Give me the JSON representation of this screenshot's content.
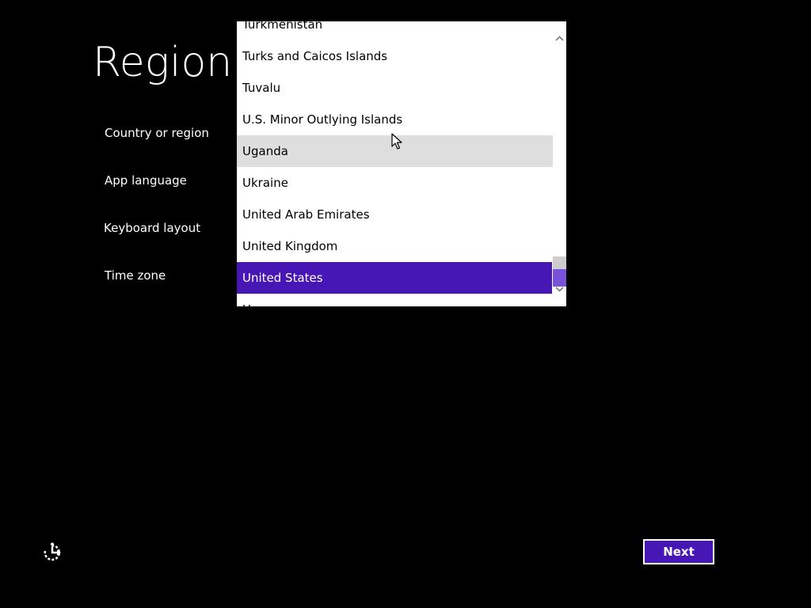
{
  "page": {
    "title": "Region"
  },
  "settings": [
    {
      "label": "Country or region"
    },
    {
      "label": "App language"
    },
    {
      "label": "Keyboard layout"
    },
    {
      "label": "Time zone"
    }
  ],
  "dropdown": {
    "items": [
      {
        "label": "Turkmenistan",
        "state": "normal"
      },
      {
        "label": "Turks and Caicos Islands",
        "state": "normal"
      },
      {
        "label": "Tuvalu",
        "state": "normal"
      },
      {
        "label": "U.S. Minor Outlying Islands",
        "state": "normal"
      },
      {
        "label": "Uganda",
        "state": "hover"
      },
      {
        "label": "Ukraine",
        "state": "normal"
      },
      {
        "label": "United Arab Emirates",
        "state": "normal"
      },
      {
        "label": "United Kingdom",
        "state": "normal"
      },
      {
        "label": "United States",
        "state": "selected"
      },
      {
        "label": "Uruguay",
        "state": "normal"
      }
    ],
    "selected": "United States"
  },
  "buttons": {
    "next_label": "Next"
  },
  "colors": {
    "accent": "#4617b4",
    "hover": "#dedede",
    "background": "#000000"
  },
  "icons": {
    "ease_of_access": "ease-of-access-icon",
    "cursor": "mouse-pointer-icon",
    "scroll_up": "chevron-up-icon",
    "scroll_down": "chevron-down-icon"
  }
}
